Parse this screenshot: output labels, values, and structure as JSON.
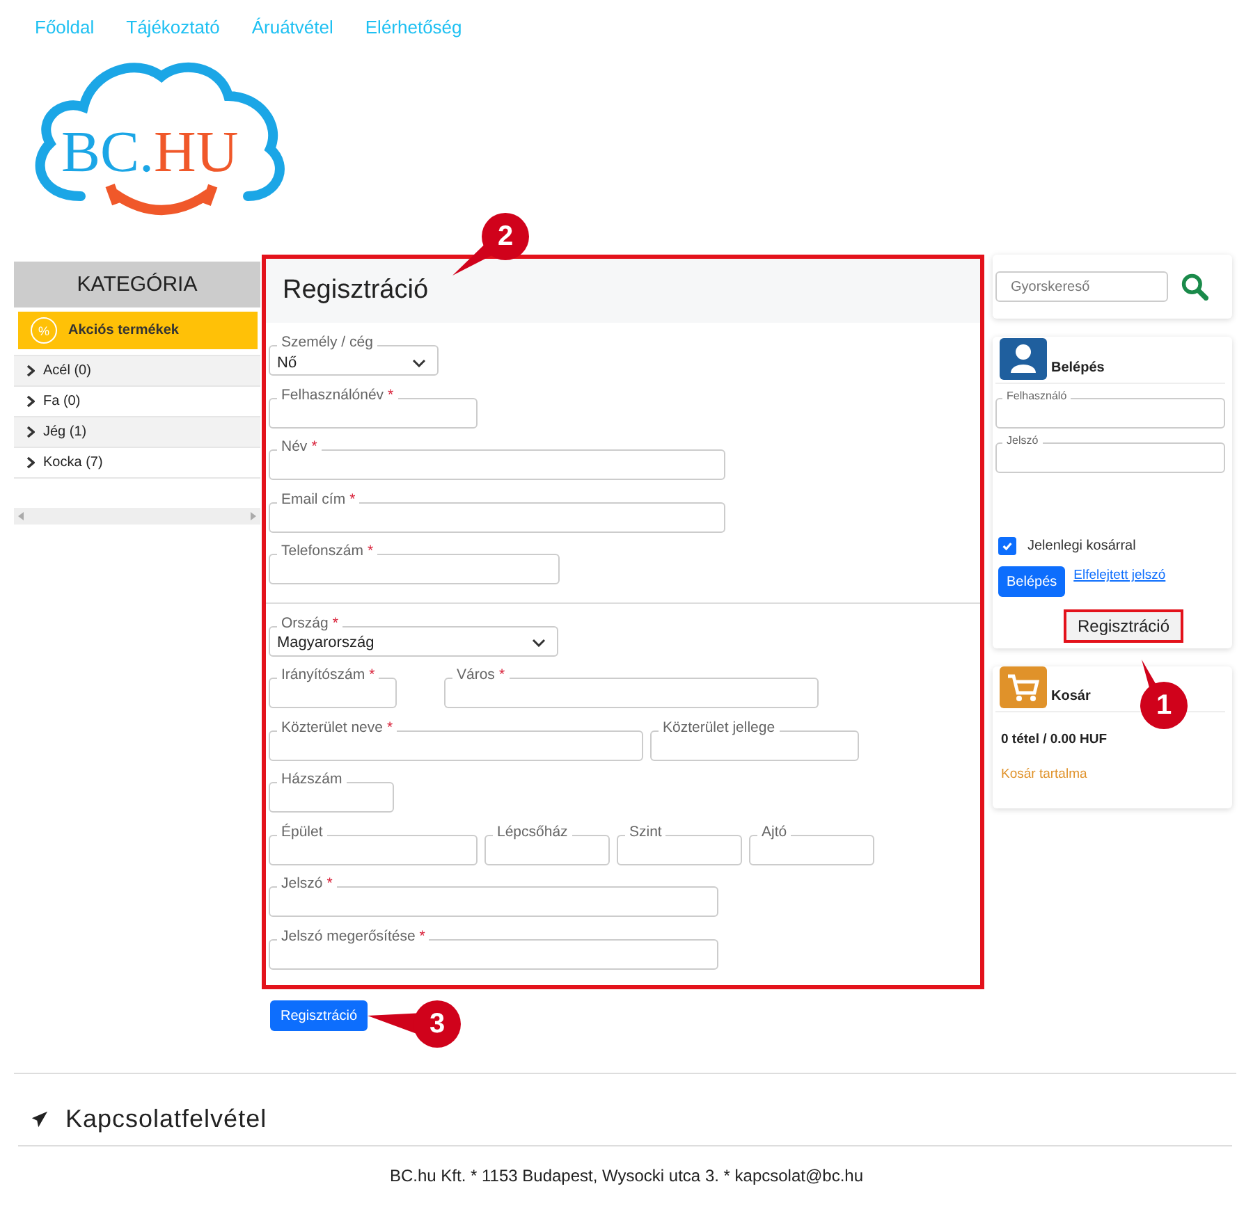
{
  "nav": [
    {
      "label": "Főoldal"
    },
    {
      "label": "Tájékoztató"
    },
    {
      "label": "Áruátvétel"
    },
    {
      "label": "Elérhetőség"
    }
  ],
  "logo": {
    "primary": "BC.",
    "accent": "HU"
  },
  "sidebar": {
    "title": "KATEGÓRIA",
    "promo": {
      "icon_text": "%",
      "label": "Akciós termékek"
    },
    "items": [
      {
        "label": "Acél (0)"
      },
      {
        "label": "Fa (0)"
      },
      {
        "label": "Jég (1)"
      },
      {
        "label": "Kocka (7)"
      }
    ]
  },
  "form": {
    "title": "Regisztráció",
    "highlighted": true,
    "sections": [
      {
        "rows": [
          [
            {
              "label": "Személy / cég",
              "kind": "select",
              "value": "Nő"
            }
          ],
          [
            {
              "label": "Felhasználónév",
              "kind": "text",
              "required_mark": "*"
            }
          ],
          [
            {
              "label": "Név",
              "kind": "text",
              "required_mark": "*"
            }
          ],
          [
            {
              "label": "Email cím",
              "kind": "text",
              "required_mark": "*"
            }
          ],
          [
            {
              "label": "Telefonszám",
              "kind": "text",
              "required_mark": "*"
            }
          ]
        ]
      },
      {
        "rows": [
          [
            {
              "label": "Ország",
              "kind": "select",
              "value": "Magyarország",
              "required_mark": "*"
            }
          ],
          [
            {
              "label": "Irányítószám",
              "kind": "text",
              "required_mark": "*"
            },
            {
              "label": "Város",
              "kind": "text",
              "required_mark": "*"
            }
          ],
          [
            {
              "label": "Közterület neve",
              "kind": "text",
              "required_mark": "*"
            },
            {
              "label": "Közterület jellege",
              "kind": "text"
            }
          ],
          [
            {
              "label": "Házszám",
              "kind": "text"
            }
          ],
          [
            {
              "label": "Épület",
              "kind": "text"
            },
            {
              "label": "Lépcsőház",
              "kind": "text"
            },
            {
              "label": "Szint",
              "kind": "text"
            },
            {
              "label": "Ajtó",
              "kind": "text"
            }
          ],
          [
            {
              "label": "Jelszó",
              "kind": "text",
              "required_mark": "*"
            }
          ],
          [
            {
              "label": "Jelszó megerősítése",
              "kind": "text",
              "required_mark": "*"
            }
          ]
        ]
      }
    ],
    "submit": "Regisztráció"
  },
  "search": {
    "placeholder": "Gyorskereső"
  },
  "login": {
    "title": "Belépés",
    "fields": [
      {
        "label": "Felhasználó"
      },
      {
        "label": "Jelszó"
      }
    ],
    "remember": {
      "label": "Jelenlegi kosárral",
      "checked": true
    },
    "button": "Belépés",
    "forgot_link": "Elfelejtett jelszó",
    "register_popup": {
      "label": "Regisztráció",
      "highlighted": true
    }
  },
  "cart": {
    "title": "Kosár",
    "summary": "0 tétel / 0.00 HUF",
    "link": "Kosár tartalma"
  },
  "footer": {
    "contact_heading": "Kapcsolatfelvétel",
    "address": "BC.hu Kft. * 1153 Budapest, Wysocki utca 3. * kapcsolat@bc.hu"
  },
  "annotations": [
    {
      "number": "1"
    },
    {
      "number": "2"
    },
    {
      "number": "3"
    }
  ]
}
